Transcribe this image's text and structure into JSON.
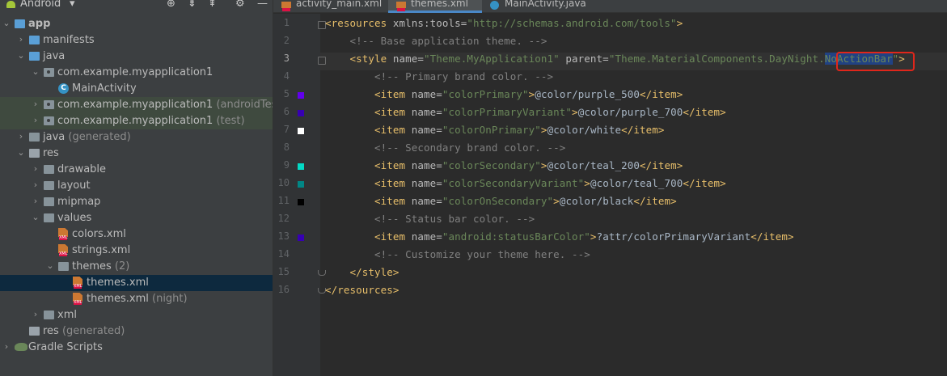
{
  "project": {
    "view_label": "Android",
    "header_icons": [
      "globe-icon",
      "collapse-all-icon",
      "expand-all-icon",
      "gear-icon",
      "minimize-icon"
    ]
  },
  "tree": [
    {
      "label": "app",
      "dim": "",
      "icon": "module",
      "depth": 0,
      "expanded": true
    },
    {
      "label": "manifests",
      "dim": "",
      "icon": "folder-blue",
      "depth": 1,
      "expanded": false
    },
    {
      "label": "java",
      "dim": "",
      "icon": "folder-blue",
      "depth": 1,
      "expanded": true
    },
    {
      "label": "com.example.myapplication1",
      "dim": "",
      "icon": "package",
      "depth": 2,
      "expanded": true
    },
    {
      "label": "MainActivity",
      "dim": "",
      "icon": "class",
      "depth": 3,
      "expanded": null
    },
    {
      "label": "com.example.myapplication1",
      "dim": "(androidTest)",
      "icon": "package",
      "depth": 2,
      "expanded": false
    },
    {
      "label": "com.example.myapplication1",
      "dim": "(test)",
      "icon": "package",
      "depth": 2,
      "expanded": false
    },
    {
      "label": "java",
      "dim": "(generated)",
      "icon": "folder",
      "depth": 1,
      "expanded": false
    },
    {
      "label": "res",
      "dim": "",
      "icon": "folder-res",
      "depth": 1,
      "expanded": true
    },
    {
      "label": "drawable",
      "dim": "",
      "icon": "folder",
      "depth": 2,
      "expanded": false
    },
    {
      "label": "layout",
      "dim": "",
      "icon": "folder",
      "depth": 2,
      "expanded": false
    },
    {
      "label": "mipmap",
      "dim": "",
      "icon": "folder",
      "depth": 2,
      "expanded": false
    },
    {
      "label": "values",
      "dim": "",
      "icon": "folder",
      "depth": 2,
      "expanded": true
    },
    {
      "label": "colors.xml",
      "dim": "",
      "icon": "xml",
      "depth": 3,
      "expanded": null
    },
    {
      "label": "strings.xml",
      "dim": "",
      "icon": "xml",
      "depth": 3,
      "expanded": null
    },
    {
      "label": "themes",
      "dim": "(2)",
      "icon": "folder",
      "depth": 3,
      "expanded": true
    },
    {
      "label": "themes.xml",
      "dim": "",
      "icon": "xml",
      "depth": 4,
      "expanded": null
    },
    {
      "label": "themes.xml",
      "dim": "(night)",
      "icon": "xml",
      "depth": 4,
      "expanded": null
    },
    {
      "label": "xml",
      "dim": "",
      "icon": "folder",
      "depth": 2,
      "expanded": false
    },
    {
      "label": "res",
      "dim": "(generated)",
      "icon": "folder-res",
      "depth": 1,
      "expanded": null
    },
    {
      "label": "Gradle Scripts",
      "dim": "",
      "icon": "gradle",
      "depth": 0,
      "expanded": false
    }
  ],
  "selected_row": 16,
  "highlighted_rows": [
    5,
    6
  ],
  "tabs": [
    {
      "label": "activity_main.xml",
      "icon": "xml",
      "active": false
    },
    {
      "label": "themes.xml",
      "icon": "xml",
      "active": true
    },
    {
      "label": "MainActivity.java",
      "icon": "java",
      "active": false
    }
  ],
  "editor": {
    "current_line": 3,
    "lines": [
      [
        [
          "tg",
          "<resources "
        ],
        [
          "an",
          "xmlns:tools="
        ],
        [
          "av",
          "\"http://schemas.android.com/tools\""
        ],
        [
          "tg",
          ">"
        ]
      ],
      [
        [
          "cm",
          "    <!-- Base application theme. -->"
        ]
      ],
      [
        [
          "tg",
          "    <style "
        ],
        [
          "an",
          "name="
        ],
        [
          "av",
          "\"Theme.MyApplication1\" "
        ],
        [
          "an",
          "parent="
        ],
        [
          "av",
          "\"Theme.MaterialComponents.DayNight."
        ],
        [
          "selt",
          "NoActionBar"
        ],
        [
          "av",
          "\""
        ],
        [
          "tg",
          ">"
        ]
      ],
      [
        [
          "cm",
          "        <!-- Primary brand color. -->"
        ]
      ],
      [
        [
          "tg",
          "        <item "
        ],
        [
          "an",
          "name="
        ],
        [
          "av",
          "\"colorPrimary\""
        ],
        [
          "tg",
          ">"
        ],
        [
          "tx",
          "@color/purple_500"
        ],
        [
          "tg",
          "</item>"
        ]
      ],
      [
        [
          "tg",
          "        <item "
        ],
        [
          "an",
          "name="
        ],
        [
          "av",
          "\"colorPrimaryVariant\""
        ],
        [
          "tg",
          ">"
        ],
        [
          "tx",
          "@color/purple_700"
        ],
        [
          "tg",
          "</item>"
        ]
      ],
      [
        [
          "tg",
          "        <item "
        ],
        [
          "an",
          "name="
        ],
        [
          "av",
          "\"colorOnPrimary\""
        ],
        [
          "tg",
          ">"
        ],
        [
          "tx",
          "@color/white"
        ],
        [
          "tg",
          "</item>"
        ]
      ],
      [
        [
          "cm",
          "        <!-- Secondary brand color. -->"
        ]
      ],
      [
        [
          "tg",
          "        <item "
        ],
        [
          "an",
          "name="
        ],
        [
          "av",
          "\"colorSecondary\""
        ],
        [
          "tg",
          ">"
        ],
        [
          "tx",
          "@color/teal_200"
        ],
        [
          "tg",
          "</item>"
        ]
      ],
      [
        [
          "tg",
          "        <item "
        ],
        [
          "an",
          "name="
        ],
        [
          "av",
          "\"colorSecondaryVariant\""
        ],
        [
          "tg",
          ">"
        ],
        [
          "tx",
          "@color/teal_700"
        ],
        [
          "tg",
          "</item>"
        ]
      ],
      [
        [
          "tg",
          "        <item "
        ],
        [
          "an",
          "name="
        ],
        [
          "av",
          "\"colorOnSecondary\""
        ],
        [
          "tg",
          ">"
        ],
        [
          "tx",
          "@color/black"
        ],
        [
          "tg",
          "</item>"
        ]
      ],
      [
        [
          "cm",
          "        <!-- Status bar color. -->"
        ]
      ],
      [
        [
          "tg",
          "        <item "
        ],
        [
          "an",
          "name="
        ],
        [
          "av",
          "\"android:statusBarColor\""
        ],
        [
          "tg",
          ">"
        ],
        [
          "tx",
          "?attr/colorPrimaryVariant"
        ],
        [
          "tg",
          "</item>"
        ]
      ],
      [
        [
          "cm",
          "        <!-- Customize your theme here. -->"
        ]
      ],
      [
        [
          "tg",
          "    </style>"
        ]
      ],
      [
        [
          "tg",
          "</resources>"
        ]
      ]
    ],
    "color_swatches": [
      {
        "line": 5,
        "color": "#6200ee"
      },
      {
        "line": 6,
        "color": "#3700b3"
      },
      {
        "line": 7,
        "color": "#ffffff"
      },
      {
        "line": 9,
        "color": "#03dac5"
      },
      {
        "line": 10,
        "color": "#018786"
      },
      {
        "line": 11,
        "color": "#000000"
      },
      {
        "line": 13,
        "color": "#3700b3"
      }
    ],
    "callout_color": "#e0261b"
  }
}
